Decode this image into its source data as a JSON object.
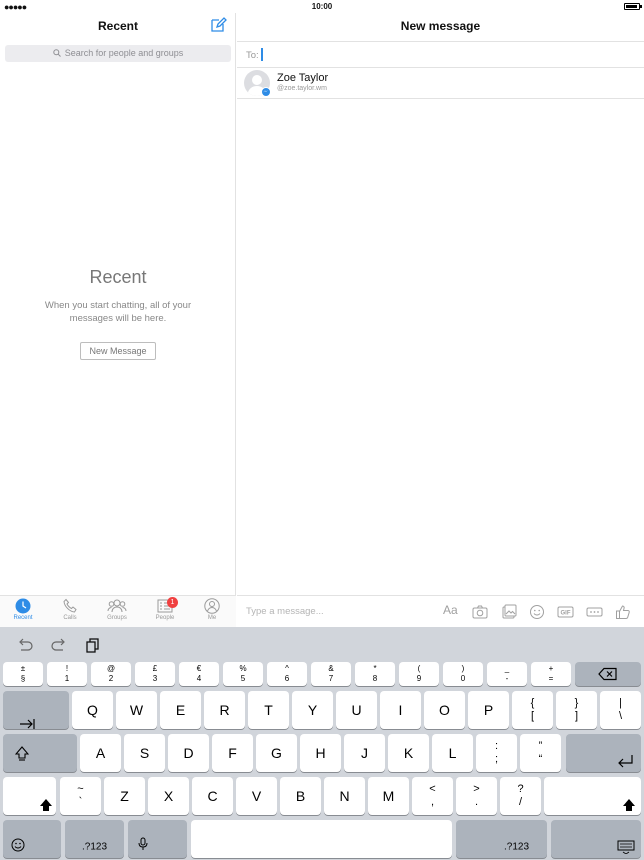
{
  "status_bar": {
    "time": "10:00",
    "signal": "●●●●●"
  },
  "left_pane": {
    "title": "Recent",
    "search_placeholder": "Search for people and groups",
    "empty_title": "Recent",
    "empty_text": "When you start chatting, all of your messages will be here.",
    "new_message_button": "New Message",
    "tabs": [
      {
        "label": "Recent",
        "icon": "clock-icon",
        "active": true
      },
      {
        "label": "Calls",
        "icon": "phone-icon"
      },
      {
        "label": "Groups",
        "icon": "groups-icon"
      },
      {
        "label": "People",
        "icon": "people-list-icon",
        "badge": "1"
      },
      {
        "label": "Me",
        "icon": "profile-icon"
      }
    ]
  },
  "right_pane": {
    "title": "New message",
    "to_label": "To:",
    "contact": {
      "name": "Zoe Taylor",
      "handle": "@zoe.taylor.wm"
    },
    "composer_placeholder": "Type a message...",
    "aa_label": "Aa",
    "gif_label": "GIF"
  },
  "keyboard": {
    "number_row": [
      [
        "±",
        "§"
      ],
      [
        "!",
        "1"
      ],
      [
        "@",
        "2"
      ],
      [
        "£",
        "3"
      ],
      [
        "€",
        "4"
      ],
      [
        "%",
        "5"
      ],
      [
        "^",
        "6"
      ],
      [
        "&",
        "7"
      ],
      [
        "*",
        "8"
      ],
      [
        "(",
        "9"
      ],
      [
        ")",
        "0"
      ],
      [
        "_",
        "-"
      ],
      [
        "+",
        "="
      ]
    ],
    "row1": [
      "Q",
      "W",
      "E",
      "R",
      "T",
      "Y",
      "U",
      "I",
      "O",
      "P"
    ],
    "row1_extra": [
      [
        "{",
        "["
      ],
      [
        "}",
        "]"
      ],
      [
        "|",
        "\\"
      ]
    ],
    "row2": [
      "A",
      "S",
      "D",
      "F",
      "G",
      "H",
      "J",
      "K",
      "L"
    ],
    "row2_extra": [
      [
        ":",
        ";"
      ],
      [
        "”",
        "“"
      ]
    ],
    "row3": [
      "Z",
      "X",
      "C",
      "V",
      "B",
      "N",
      "M"
    ],
    "row3_extra": [
      [
        "~",
        "`"
      ],
      [
        "<",
        ","
      ],
      [
        ">",
        "."
      ],
      [
        "?",
        "/"
      ]
    ],
    "numbers_label": ".?123"
  },
  "colors": {
    "accent": "#2e8ce6",
    "badge": "#f04040",
    "keyboard_bg": "#d1d5db"
  }
}
